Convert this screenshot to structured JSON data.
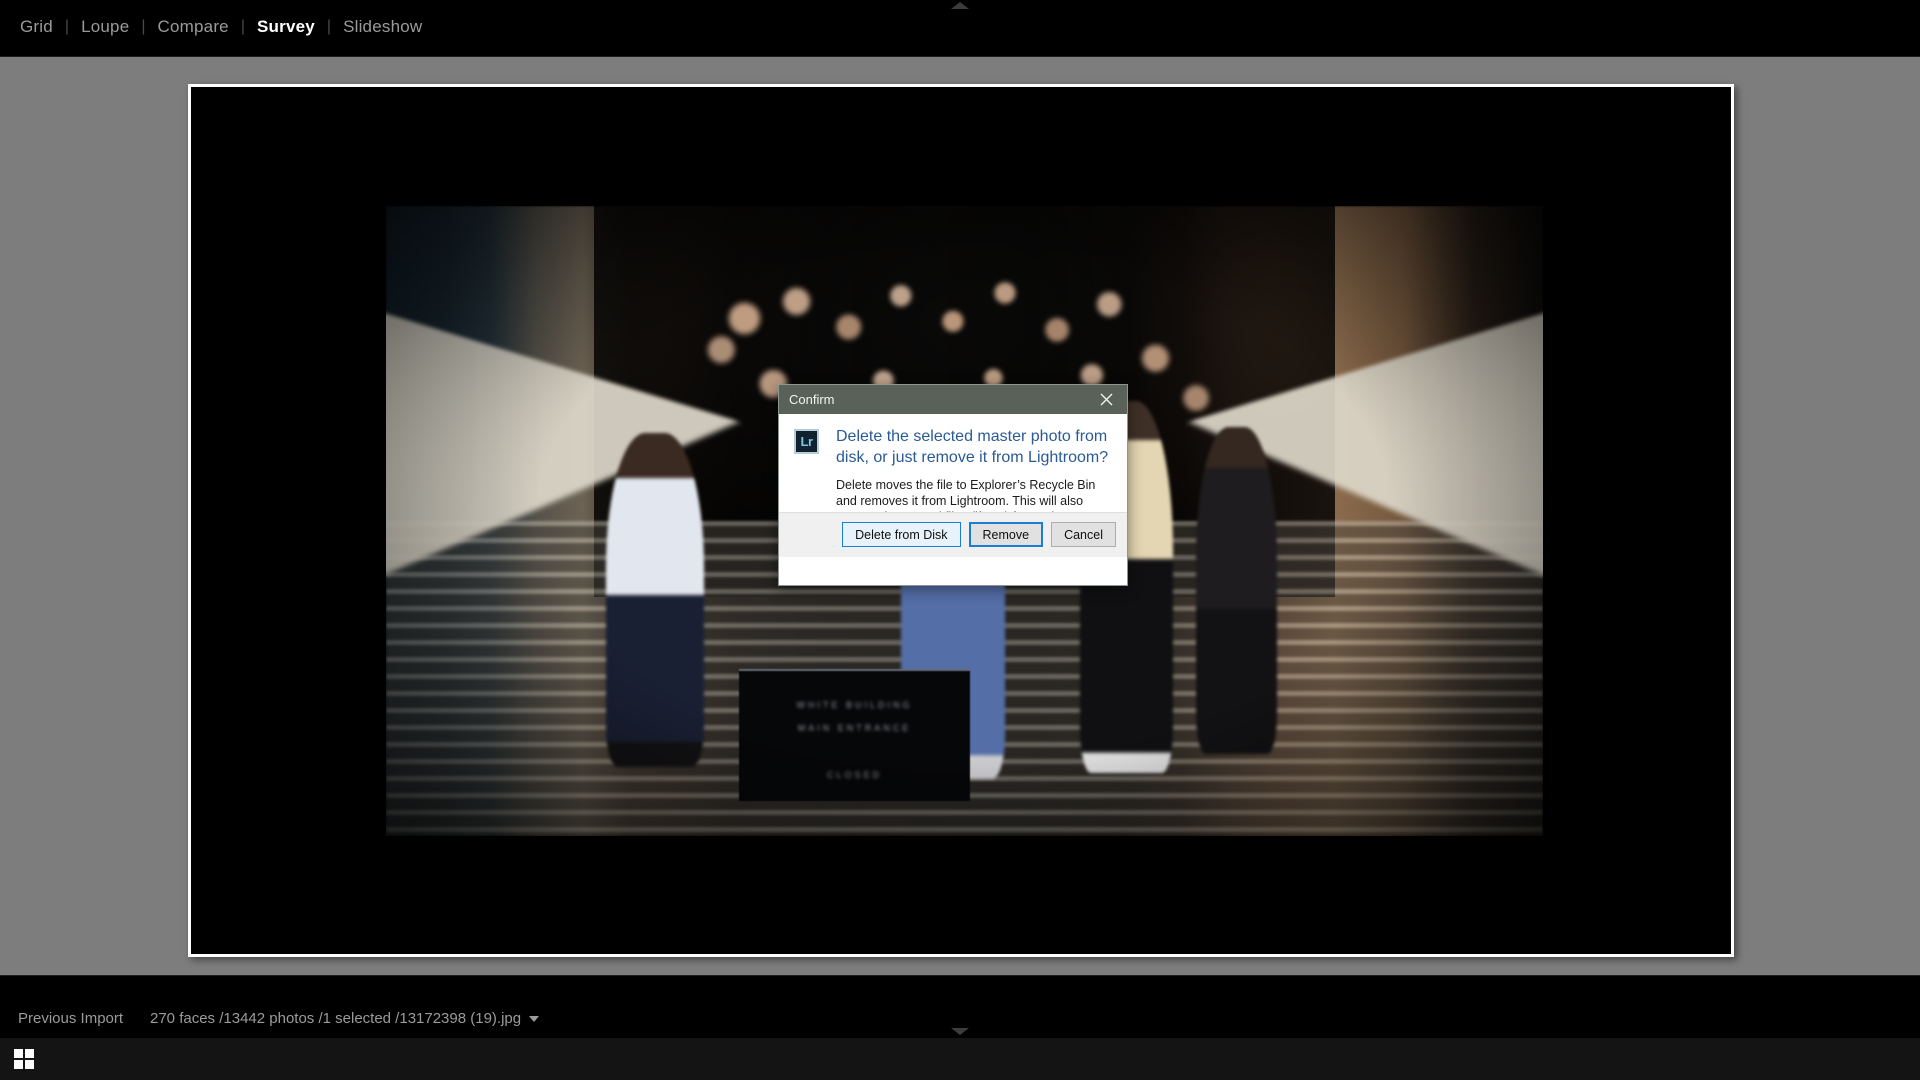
{
  "app": {
    "name": "Adobe Photoshop Lightroom",
    "module_bar": {
      "items": [
        {
          "label": "Grid",
          "active": false
        },
        {
          "label": "Loupe",
          "active": false
        },
        {
          "label": "Compare",
          "active": false
        },
        {
          "label": "Survey",
          "active": true
        },
        {
          "label": "Slideshow",
          "active": false
        }
      ],
      "separator": "|"
    }
  },
  "workarea": {
    "photo": {
      "sign_line_1": "WHITE BUILDING",
      "sign_line_2": "MAIN ENTRANCE",
      "sign_line_3": "CLOSED"
    }
  },
  "statusbar": {
    "source": "Previous Import",
    "counts": "270 faces /13442 photos /1 selected /13172398 (19).jpg",
    "caret_icon": "chevron-down-icon"
  },
  "taskbar": {
    "start_icon": "windows-start-icon"
  },
  "dialog": {
    "title": "Confirm",
    "close_icon": "close-icon",
    "app_icon_label": "Lr",
    "heading": "Delete the selected master photo from disk, or just remove it from Lightroom?",
    "body": "Delete moves the file to Explorer’s Recycle Bin and removes it from Lightroom.  This will also remove the synced files (if any) from other Lightroom CC clients.",
    "buttons": [
      {
        "label": "Delete from Disk",
        "style": "focus-light"
      },
      {
        "label": "Remove",
        "style": "default"
      },
      {
        "label": "Cancel",
        "style": "normal"
      }
    ]
  },
  "colors": {
    "module_bar_bg": "#000000",
    "workarea_bg": "#7d7d7d",
    "photo_cell_bg": "#000000",
    "photo_cell_border": "#ffffff",
    "dialog_title_bg": "#5a6159",
    "dialog_heading_text": "#2a5a96",
    "dialog_footer_bg": "#f0f0f0",
    "button_accent": "#1a7fd4",
    "status_text": "#9b9b9b",
    "taskbar_bg": "#141414"
  }
}
